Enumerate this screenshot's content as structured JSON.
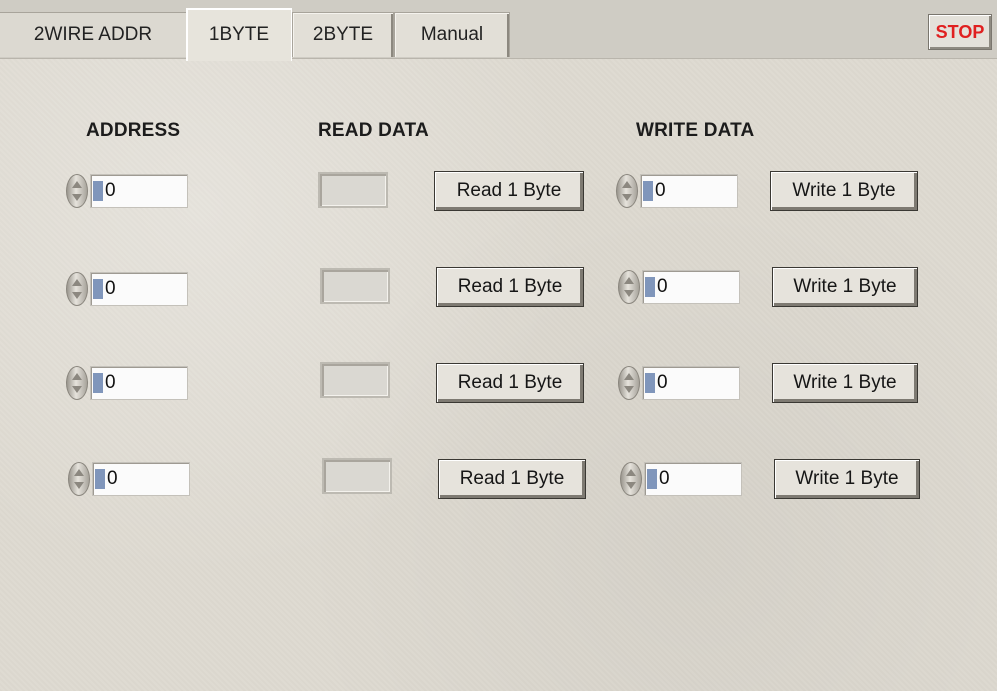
{
  "tabs": [
    {
      "label": "2WIRE ADDR"
    },
    {
      "label": "1BYTE"
    },
    {
      "label": "2BYTE"
    },
    {
      "label": "Manual"
    }
  ],
  "stop_label": "STOP",
  "headings": {
    "address": "ADDRESS",
    "read_data": "READ DATA",
    "write_data": "WRITE DATA"
  },
  "rows": [
    {
      "address": "0",
      "read_button": "Read 1 Byte",
      "write_value": "0",
      "write_button": "Write 1 Byte"
    },
    {
      "address": "0",
      "read_button": "Read 1 Byte",
      "write_value": "0",
      "write_button": "Write 1 Byte"
    },
    {
      "address": "0",
      "read_button": "Read 1 Byte",
      "write_value": "0",
      "write_button": "Write 1 Byte"
    },
    {
      "address": "0",
      "read_button": "Read 1 Byte",
      "write_value": "0",
      "write_button": "Write 1 Byte"
    }
  ],
  "colors": {
    "stop_text": "#e02020",
    "panel_bg": "#dedad1"
  }
}
